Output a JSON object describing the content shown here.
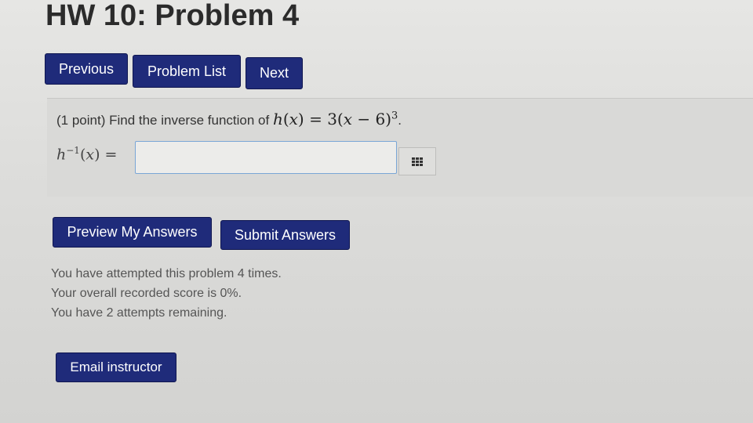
{
  "page": {
    "title": "HW 10: Problem 4"
  },
  "nav": {
    "previous_label": "Previous",
    "problem_list_label": "Problem List",
    "next_label": "Next"
  },
  "problem": {
    "prompt_text": "(1 point) Find the inverse function of ",
    "function_name": "h",
    "function_arg": "x",
    "function_expr_prefix": " = 3(",
    "function_expr_mid": " − 6)",
    "exponent": "3",
    "period": ".",
    "answer_label_name": "h",
    "answer_label_sup": "−1",
    "answer_label_arg": "x",
    "answer_value": "",
    "answer_placeholder": ""
  },
  "actions": {
    "preview_label": "Preview My Answers",
    "submit_label": "Submit Answers"
  },
  "status": {
    "attempts": "You have attempted this problem 4 times.",
    "score": "Your overall recorded score is 0%.",
    "remaining": "You have 2 attempts remaining."
  },
  "email": {
    "label": "Email instructor"
  },
  "colors": {
    "button_bg": "#1f2b7a",
    "input_border": "#7aa6d6"
  },
  "icons": {
    "equation_editor": "grid-icon"
  }
}
